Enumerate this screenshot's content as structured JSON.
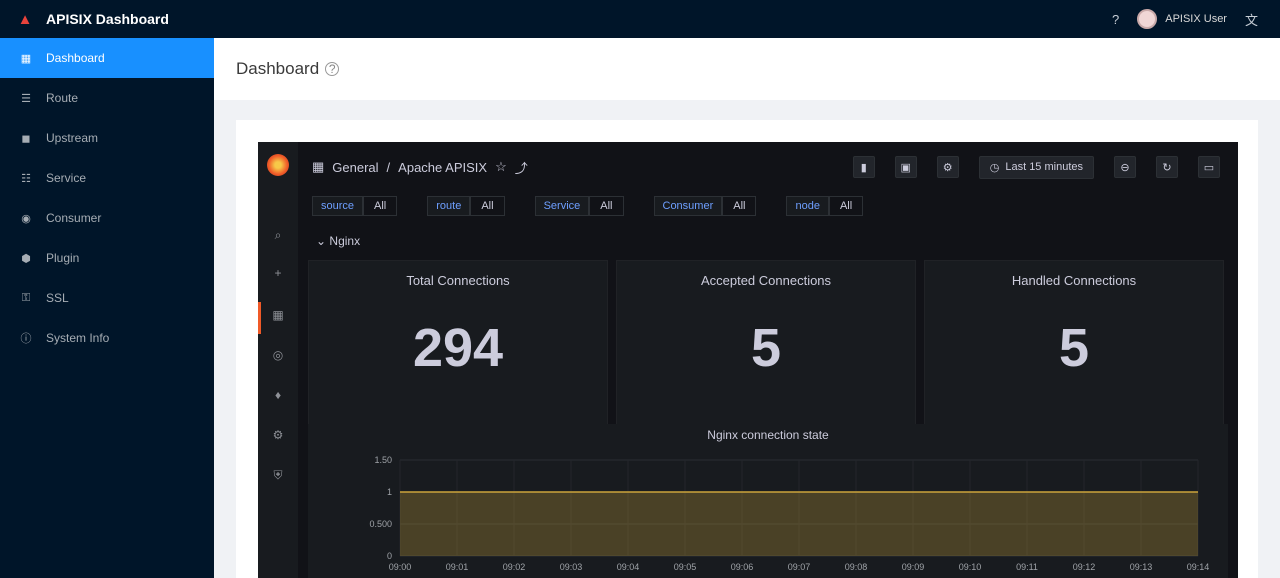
{
  "header": {
    "title": "APISIX Dashboard",
    "user": "APISIX User"
  },
  "sidebar": {
    "items": [
      {
        "label": "Dashboard",
        "icon": "dashboard-icon",
        "active": true
      },
      {
        "label": "Route",
        "icon": "route-icon",
        "active": false
      },
      {
        "label": "Upstream",
        "icon": "upstream-icon",
        "active": false
      },
      {
        "label": "Service",
        "icon": "service-icon",
        "active": false
      },
      {
        "label": "Consumer",
        "icon": "consumer-icon",
        "active": false
      },
      {
        "label": "Plugin",
        "icon": "plugin-icon",
        "active": false
      },
      {
        "label": "SSL",
        "icon": "ssl-icon",
        "active": false
      },
      {
        "label": "System Info",
        "icon": "info-icon",
        "active": false
      }
    ]
  },
  "page": {
    "title": "Dashboard"
  },
  "grafana": {
    "breadcrumb_folder": "General",
    "breadcrumb_dashboard": "Apache APISIX",
    "time_range": "Last 15 minutes",
    "variables": [
      {
        "label": "source",
        "value": "All"
      },
      {
        "label": "route",
        "value": "All"
      },
      {
        "label": "Service",
        "value": "All"
      },
      {
        "label": "Consumer",
        "value": "All"
      },
      {
        "label": "node",
        "value": "All"
      }
    ],
    "row_title": "Nginx",
    "stats": [
      {
        "title": "Total Connections",
        "value": "294"
      },
      {
        "title": "Accepted Connections",
        "value": "5"
      },
      {
        "title": "Handled Connections",
        "value": "5"
      }
    ],
    "timeseries_title": "Nginx connection state"
  },
  "chart_data": {
    "type": "area",
    "title": "Nginx connection state",
    "ylabel": "",
    "y_ticks": [
      "1.50",
      "1",
      "0.500",
      "0"
    ],
    "ylim": [
      0,
      1.5
    ],
    "x": [
      "09:00",
      "09:01",
      "09:02",
      "09:03",
      "09:04",
      "09:05",
      "09:06",
      "09:07",
      "09:08",
      "09:09",
      "09:10",
      "09:11",
      "09:12",
      "09:13",
      "09:14"
    ],
    "series": [
      {
        "values": [
          1,
          1,
          1,
          1,
          1,
          1,
          1,
          1,
          1,
          1,
          1,
          1,
          1,
          1,
          1
        ]
      }
    ],
    "colors": {
      "series": "#cca43b"
    }
  }
}
